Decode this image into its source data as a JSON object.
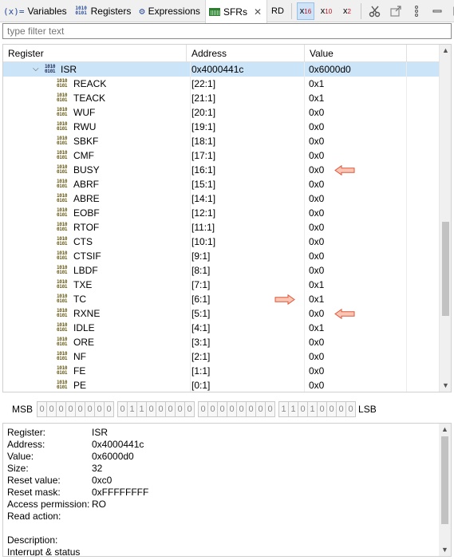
{
  "tabs": [
    {
      "label": "Variables",
      "icon": "variables-icon"
    },
    {
      "label": "Registers",
      "icon": "registers-binary-icon"
    },
    {
      "label": "Expressions",
      "icon": "expressions-icon"
    },
    {
      "label": "SFRs",
      "icon": "sfr-icon",
      "close": "✕"
    }
  ],
  "toolbar": {
    "rd": "RD",
    "hex": "x",
    "hex_sub": "16",
    "dec": "x",
    "dec_sub": "10",
    "bin": "x",
    "bin_sub": "2"
  },
  "filter": {
    "placeholder": "type filter text"
  },
  "table": {
    "headers": {
      "register": "Register",
      "address": "Address",
      "value": "Value"
    },
    "parent": {
      "name": "ISR",
      "address": "0x4000441c",
      "value": "0x6000d0"
    },
    "fields": [
      {
        "name": "REACK",
        "address": "[22:1]",
        "value": "0x1"
      },
      {
        "name": "TEACK",
        "address": "[21:1]",
        "value": "0x1"
      },
      {
        "name": "WUF",
        "address": "[20:1]",
        "value": "0x0"
      },
      {
        "name": "RWU",
        "address": "[19:1]",
        "value": "0x0"
      },
      {
        "name": "SBKF",
        "address": "[18:1]",
        "value": "0x0"
      },
      {
        "name": "CMF",
        "address": "[17:1]",
        "value": "0x0"
      },
      {
        "name": "BUSY",
        "address": "[16:1]",
        "value": "0x0"
      },
      {
        "name": "ABRF",
        "address": "[15:1]",
        "value": "0x0"
      },
      {
        "name": "ABRE",
        "address": "[14:1]",
        "value": "0x0"
      },
      {
        "name": "EOBF",
        "address": "[12:1]",
        "value": "0x0"
      },
      {
        "name": "RTOF",
        "address": "[11:1]",
        "value": "0x0"
      },
      {
        "name": "CTS",
        "address": "[10:1]",
        "value": "0x0"
      },
      {
        "name": "CTSIF",
        "address": "[9:1]",
        "value": "0x0"
      },
      {
        "name": "LBDF",
        "address": "[8:1]",
        "value": "0x0"
      },
      {
        "name": "TXE",
        "address": "[7:1]",
        "value": "0x1"
      },
      {
        "name": "TC",
        "address": "[6:1]",
        "value": "0x1"
      },
      {
        "name": "RXNE",
        "address": "[5:1]",
        "value": "0x0"
      },
      {
        "name": "IDLE",
        "address": "[4:1]",
        "value": "0x1"
      },
      {
        "name": "ORE",
        "address": "[3:1]",
        "value": "0x0"
      },
      {
        "name": "NF",
        "address": "[2:1]",
        "value": "0x0"
      },
      {
        "name": "FE",
        "address": "[1:1]",
        "value": "0x0"
      },
      {
        "name": "PE",
        "address": "[0:1]",
        "value": "0x0"
      }
    ]
  },
  "bits": {
    "msb": "MSB",
    "lsb": "LSB",
    "groups": [
      [
        "0",
        "0",
        "0",
        "0",
        "0",
        "0",
        "0",
        "0"
      ],
      [
        "0",
        "1",
        "1",
        "0",
        "0",
        "0",
        "0",
        "0"
      ],
      [
        "0",
        "0",
        "0",
        "0",
        "0",
        "0",
        "0",
        "0"
      ],
      [
        "1",
        "1",
        "0",
        "1",
        "0",
        "0",
        "0",
        "0"
      ]
    ]
  },
  "details": [
    {
      "key": "Register:",
      "value": "ISR"
    },
    {
      "key": "Address:",
      "value": "0x4000441c"
    },
    {
      "key": "Value:",
      "value": "0x6000d0"
    },
    {
      "key": "Size:",
      "value": "32"
    },
    {
      "key": "Reset value:",
      "value": "0xc0"
    },
    {
      "key": "Reset mask:",
      "value": "0xFFFFFFFF"
    },
    {
      "key": "Access permission:",
      "value": "RO"
    },
    {
      "key": "Read action:",
      "value": ""
    },
    {
      "key": "",
      "value": ""
    },
    {
      "key": "Description:",
      "value": ""
    },
    {
      "key": "Interrupt & status",
      "value": ""
    }
  ],
  "colors": {
    "selection": "#cce4f7",
    "arrow_fill": "#f9c6b4",
    "arrow_stroke": "#e2553a"
  }
}
